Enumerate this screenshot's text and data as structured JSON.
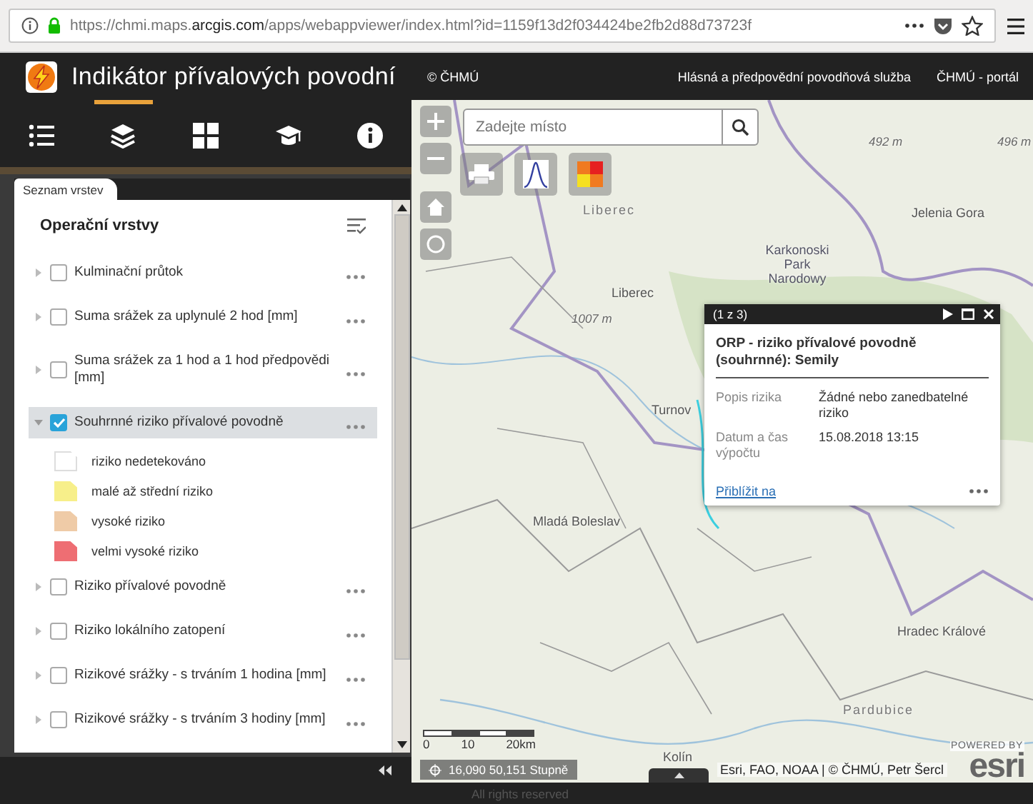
{
  "browser": {
    "url_prefix": "https://chmi.maps.",
    "url_domain": "arcgis.com",
    "url_path": "/apps/webappviewer/index.html?id=1159f13d2f034424be2fb2d88d73723f"
  },
  "header": {
    "title": "Indikátor přívalových povodní",
    "copyright": "© ČHMÚ",
    "links": [
      "Hlásná a předpovědní povodňová služba",
      "ČHMÚ - portál"
    ]
  },
  "widget_tabs": [
    {
      "kind": "list",
      "selected": false
    },
    {
      "kind": "layers",
      "selected": true
    },
    {
      "kind": "grid",
      "selected": false
    },
    {
      "kind": "cap",
      "selected": false
    },
    {
      "kind": "info",
      "selected": false
    }
  ],
  "layer_panel": {
    "tab": "Seznam vrstev",
    "heading": "Operační vrstvy",
    "layers": [
      {
        "label": "Kulminační průtok",
        "checked": false,
        "expanded": false
      },
      {
        "label": "Suma srážek za uplynulé 2 hod [mm]",
        "checked": false,
        "expanded": false
      },
      {
        "label": "Suma srážek za 1 hod a 1 hod předpovědi [mm]",
        "checked": false,
        "expanded": false
      },
      {
        "label": "Souhrnné riziko přívalové povodně",
        "checked": true,
        "expanded": true,
        "selected": true,
        "legend": [
          {
            "label": "riziko nedetekováno",
            "color": "#ffffff"
          },
          {
            "label": "malé až střední riziko",
            "color": "#f7ef8a"
          },
          {
            "label": "vysoké riziko",
            "color": "#efcba7"
          },
          {
            "label": "velmi vysoké riziko",
            "color": "#ee6e73"
          }
        ]
      },
      {
        "label": "Riziko přívalové povodně",
        "checked": false,
        "expanded": false
      },
      {
        "label": "Riziko lokálního zatopení",
        "checked": false,
        "expanded": false
      },
      {
        "label": "Rizikové srážky - s trváním 1 hodina [mm]",
        "checked": false,
        "expanded": false
      },
      {
        "label": "Rizikové srážky - s trváním 3 hodiny [mm]",
        "checked": false,
        "expanded": false
      }
    ]
  },
  "map": {
    "search": {
      "placeholder": "Zadejte místo"
    },
    "labels": [
      {
        "text": "492 m",
        "kind": "peak"
      },
      {
        "text": "496 m",
        "kind": "peak"
      },
      {
        "text": "Liberec",
        "kind": "region"
      },
      {
        "text": "Jelenia Gora",
        "kind": "city"
      },
      {
        "text": "Karkonoski Park Narodowy",
        "kind": "park"
      },
      {
        "text": "Liberec",
        "kind": "city"
      },
      {
        "text": "1007 m",
        "kind": "peak"
      },
      {
        "text": "Turnov",
        "kind": "city"
      },
      {
        "text": "Mladá Boleslav",
        "kind": "city"
      },
      {
        "text": "Hradec Králové",
        "kind": "city"
      },
      {
        "text": "Pardubice",
        "kind": "region"
      },
      {
        "text": "Kolín",
        "kind": "city"
      }
    ],
    "popup": {
      "counter": "(1 z 3)",
      "title": "ORP - riziko přívalové povodně (souhrnné): Semily",
      "fields": [
        {
          "label": "Popis rizika",
          "value": "Žádné nebo zanedbatelné riziko"
        },
        {
          "label": "Datum a čas výpočtu",
          "value": "15.08.2018 13:15"
        }
      ],
      "link": "Přiblížit na"
    },
    "scale": [
      "0",
      "10",
      "20km"
    ],
    "coordinates": "16,090 50,151 Stupně",
    "attribution": "Esri, FAO, NOAA | © ČHMÚ, Petr Šercl",
    "logo_caption": "POWERED BY",
    "logo": "esri"
  },
  "footer": "All rights reserved"
}
